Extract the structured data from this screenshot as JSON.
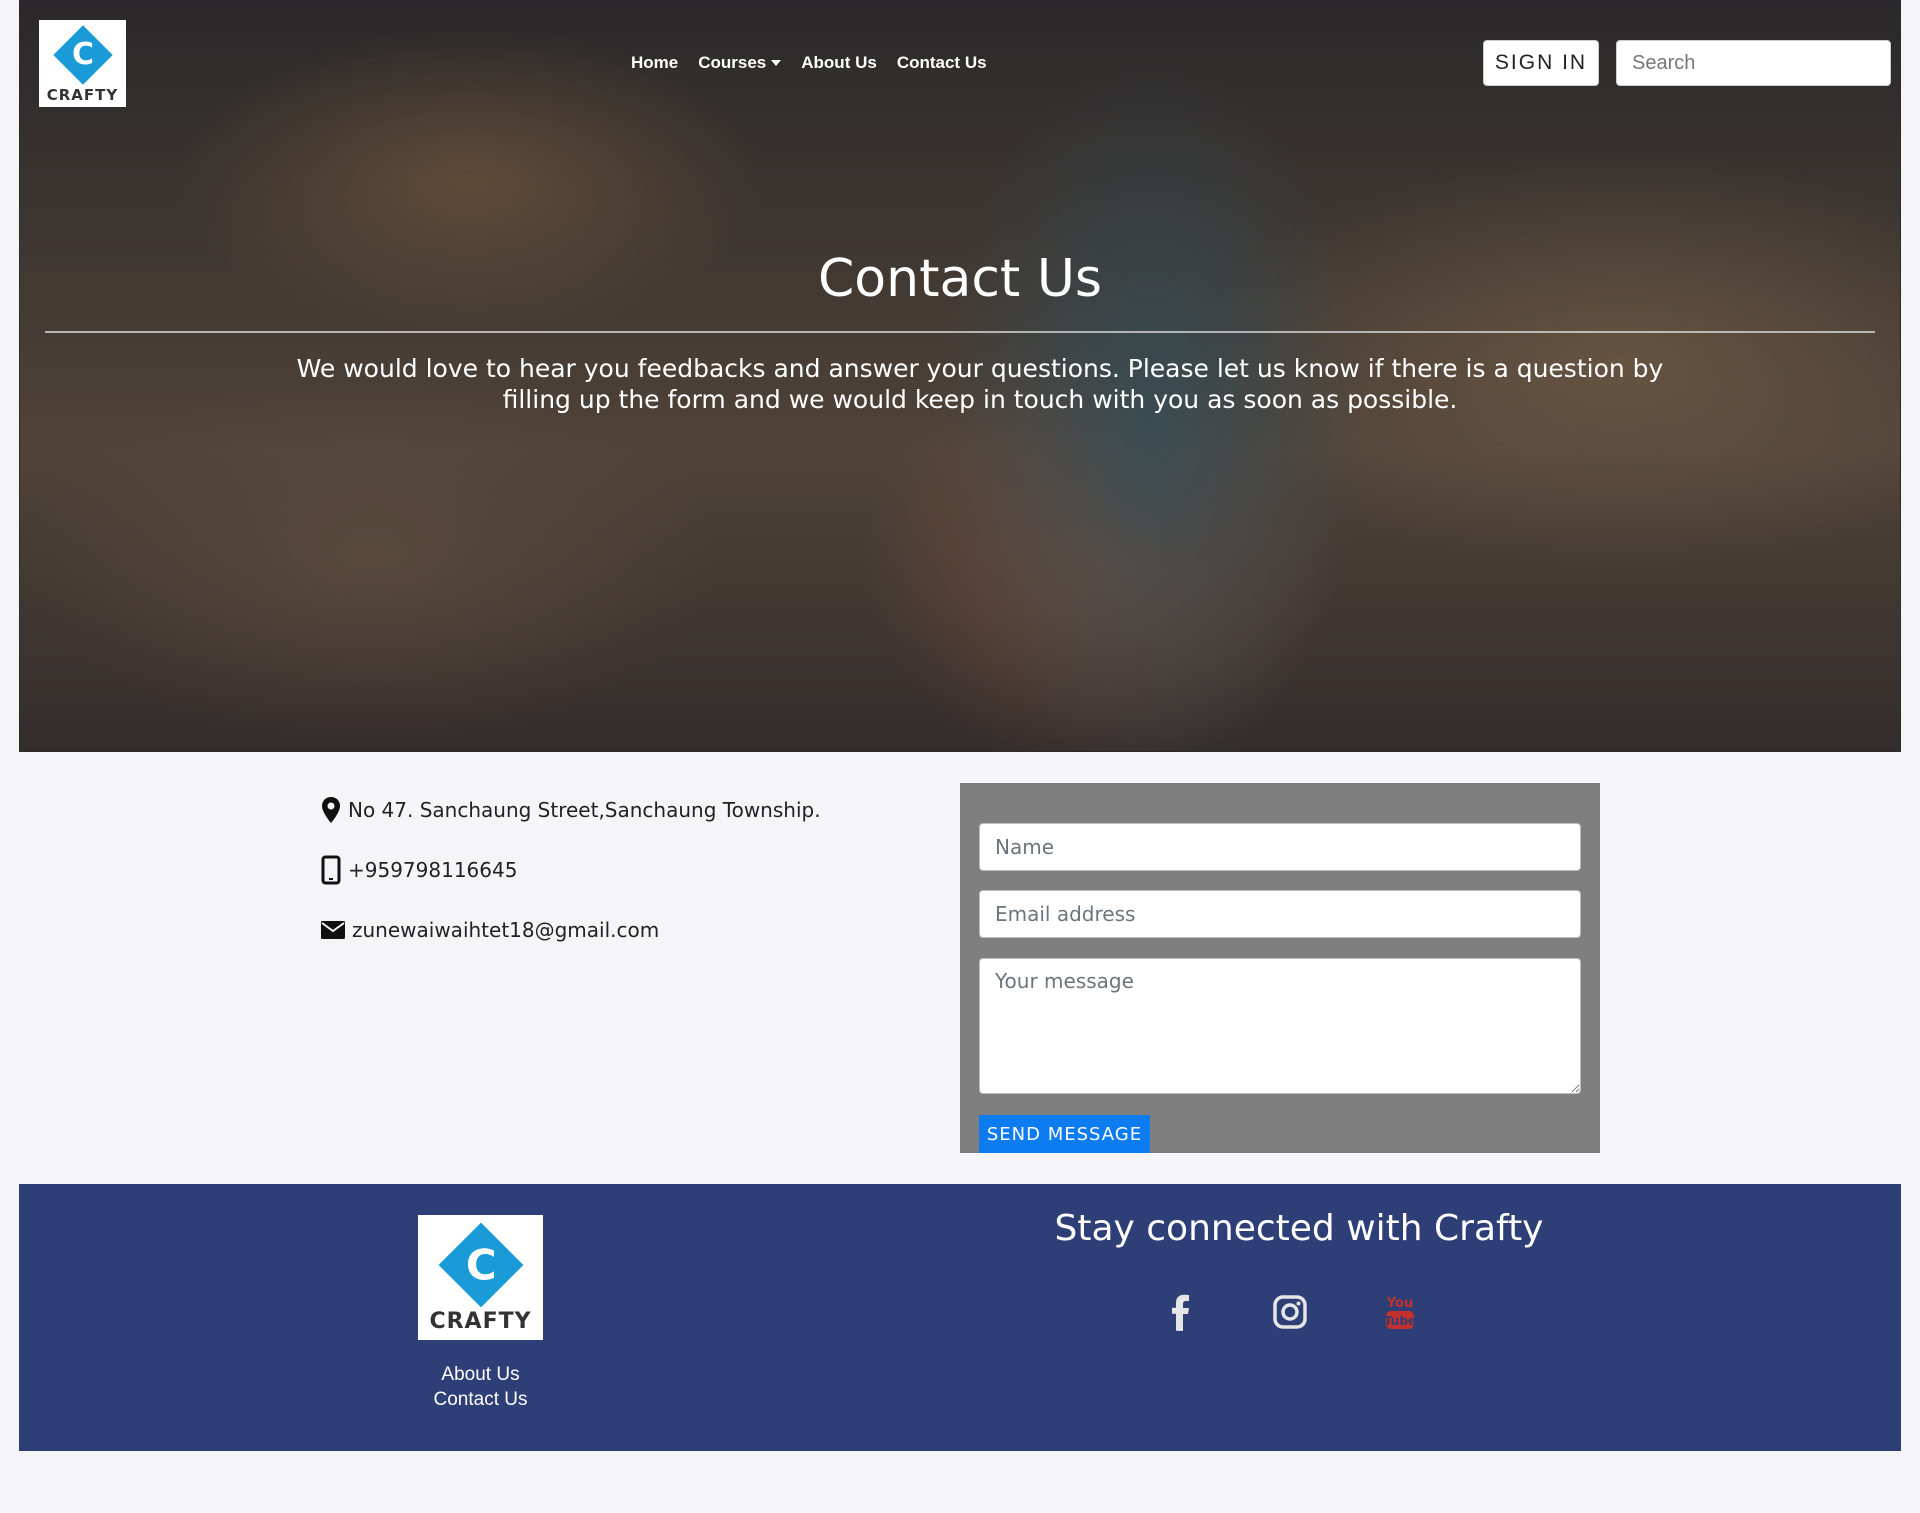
{
  "brand": {
    "logo_letter": "C",
    "logo_word": "CRAFTY"
  },
  "nav": {
    "items": [
      {
        "label": "Home"
      },
      {
        "label": "Courses"
      },
      {
        "label": "About Us"
      },
      {
        "label": "Contact Us"
      }
    ],
    "signin_label": "SIGN IN",
    "search_placeholder": "Search"
  },
  "hero": {
    "title": "Contact Us",
    "text": "We would love to hear you feedbacks and answer your questions. Please let us know if there is a question by filling up the form and we would keep in touch with you as soon as possible."
  },
  "contact": {
    "address": "No 47. Sanchaung Street,Sanchaung Township.",
    "phone": "+959798116645",
    "email": "zunewaiwaihtet18@gmail.com"
  },
  "form": {
    "name_placeholder": "Name",
    "email_placeholder": "Email address",
    "message_placeholder": "Your message",
    "send_label": "SEND MESSAGE"
  },
  "footer": {
    "links": [
      {
        "label": "About Us"
      },
      {
        "label": "Contact Us"
      }
    ],
    "heading": "Stay connected with Crafty",
    "social": [
      "facebook-icon",
      "instagram-icon",
      "youtube-icon"
    ]
  },
  "colors": {
    "footer_bg": "#2e3f78",
    "form_bg": "#7f7f7f",
    "button_blue": "#0d7cf0",
    "logo_blue": "#1a9ad6",
    "youtube_red": "#c4302b"
  }
}
